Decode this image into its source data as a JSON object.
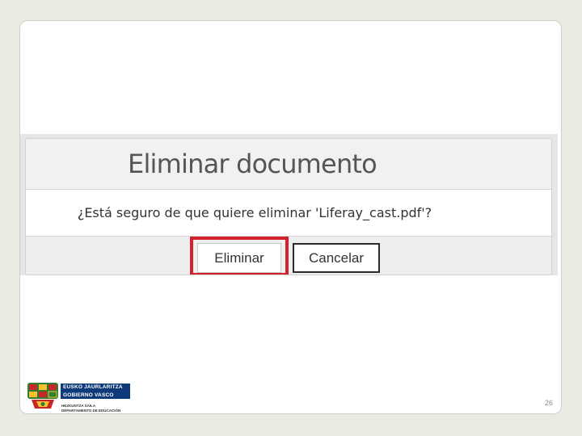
{
  "dialog": {
    "title": "Eliminar documento",
    "message": "¿Está seguro de que quiere eliminar 'Liferay_cast.pdf'?",
    "confirm_label": "Eliminar",
    "cancel_label": "Cancelar"
  },
  "logo": {
    "line1": "EUSKO JAURLARITZA",
    "line2": "GOBIERNO VASCO",
    "dept1": "HEZKUNTZA SAILA",
    "dept2": "DEPARTAMENTO DE EDUCACIÓN"
  },
  "slide": {
    "page_number": "26"
  },
  "colors": {
    "highlight": "#d3222b",
    "background": "#ecebe3",
    "logo_band": "#0e3a7a"
  },
  "icons": [
    "basque-government-coat-of-arms-icon"
  ]
}
